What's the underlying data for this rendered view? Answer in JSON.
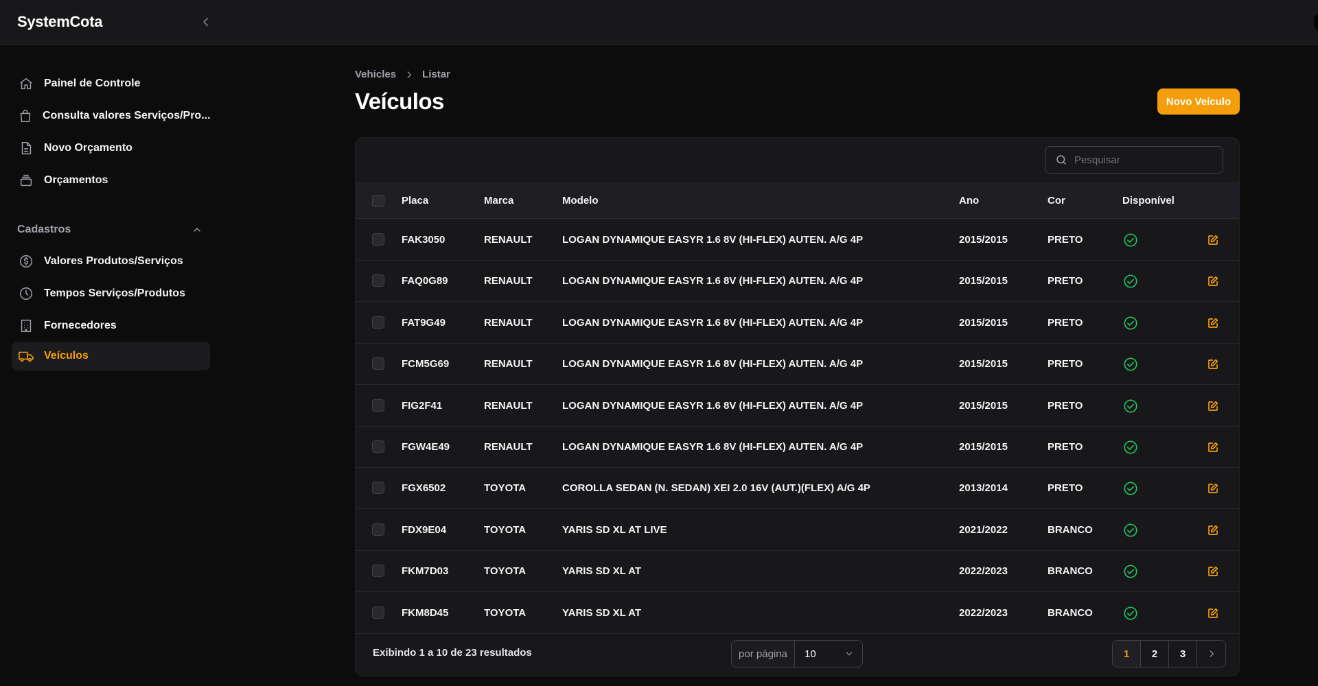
{
  "app": {
    "brand": "SystemCota"
  },
  "sidebar": {
    "items": [
      {
        "label": "Painel de Controle",
        "icon": "home-icon"
      },
      {
        "label": "Consulta valores Serviços/Pro...",
        "icon": "shopping-bag-icon"
      },
      {
        "label": "Novo Orçamento",
        "icon": "document-icon"
      },
      {
        "label": "Orçamentos",
        "icon": "inbox-stack-icon"
      }
    ],
    "group": {
      "label": "Cadastros",
      "items": [
        {
          "label": "Valores Produtos/Serviços",
          "icon": "dollar-circle-icon"
        },
        {
          "label": "Tempos Serviços/Produtos",
          "icon": "clock-icon"
        },
        {
          "label": "Fornecedores",
          "icon": "building-icon"
        },
        {
          "label": "Veículos",
          "icon": "truck-icon",
          "active": true
        }
      ]
    }
  },
  "breadcrumb": {
    "parent": "Vehicles",
    "current": "Listar"
  },
  "page": {
    "title": "Veículos",
    "new_button": "Novo Veículo"
  },
  "search": {
    "placeholder": "Pesquisar"
  },
  "table": {
    "headers": {
      "placa": "Placa",
      "marca": "Marca",
      "modelo": "Modelo",
      "ano": "Ano",
      "cor": "Cor",
      "disponivel": "Disponível"
    },
    "rows": [
      {
        "placa": "FAK3050",
        "marca": "RENAULT",
        "modelo": "LOGAN DYNAMIQUE EASYR 1.6 8V (HI-FLEX) AUTEN. A/G 4P",
        "ano": "2015/2015",
        "cor": "PRETO",
        "disponivel": true
      },
      {
        "placa": "FAQ0G89",
        "marca": "RENAULT",
        "modelo": "LOGAN DYNAMIQUE EASYR 1.6 8V (HI-FLEX) AUTEN. A/G 4P",
        "ano": "2015/2015",
        "cor": "PRETO",
        "disponivel": true
      },
      {
        "placa": "FAT9G49",
        "marca": "RENAULT",
        "modelo": "LOGAN DYNAMIQUE EASYR 1.6 8V (HI-FLEX) AUTEN. A/G 4P",
        "ano": "2015/2015",
        "cor": "PRETO",
        "disponivel": true
      },
      {
        "placa": "FCM5G69",
        "marca": "RENAULT",
        "modelo": "LOGAN DYNAMIQUE EASYR 1.6 8V (HI-FLEX) AUTEN. A/G 4P",
        "ano": "2015/2015",
        "cor": "PRETO",
        "disponivel": true
      },
      {
        "placa": "FIG2F41",
        "marca": "RENAULT",
        "modelo": "LOGAN DYNAMIQUE EASYR 1.6 8V (HI-FLEX) AUTEN. A/G 4P",
        "ano": "2015/2015",
        "cor": "PRETO",
        "disponivel": true
      },
      {
        "placa": "FGW4E49",
        "marca": "RENAULT",
        "modelo": "LOGAN DYNAMIQUE EASYR 1.6 8V (HI-FLEX) AUTEN. A/G 4P",
        "ano": "2015/2015",
        "cor": "PRETO",
        "disponivel": true
      },
      {
        "placa": "FGX6502",
        "marca": "TOYOTA",
        "modelo": "COROLLA SEDAN (N. SEDAN) XEI 2.0 16V (AUT.)(FLEX) A/G 4P",
        "ano": "2013/2014",
        "cor": "PRETO",
        "disponivel": true
      },
      {
        "placa": "FDX9E04",
        "marca": "TOYOTA",
        "modelo": "YARIS SD XL AT LIVE",
        "ano": "2021/2022",
        "cor": "BRANCO",
        "disponivel": true
      },
      {
        "placa": "FKM7D03",
        "marca": "TOYOTA",
        "modelo": "YARIS SD XL AT",
        "ano": "2022/2023",
        "cor": "BRANCO",
        "disponivel": true
      },
      {
        "placa": "FKM8D45",
        "marca": "TOYOTA",
        "modelo": "YARIS SD XL AT",
        "ano": "2022/2023",
        "cor": "BRANCO",
        "disponivel": true
      }
    ]
  },
  "footer": {
    "result_text": "Exibindo 1 a 10 de 23 resultados",
    "per_page_label": "por página",
    "per_page_value": "10",
    "pages": [
      "1",
      "2",
      "3"
    ],
    "current_page": "1"
  },
  "colors": {
    "accent": "#f59e0b",
    "success": "#22c55e",
    "background": "#0c0c0d",
    "surface": "#18181b"
  }
}
